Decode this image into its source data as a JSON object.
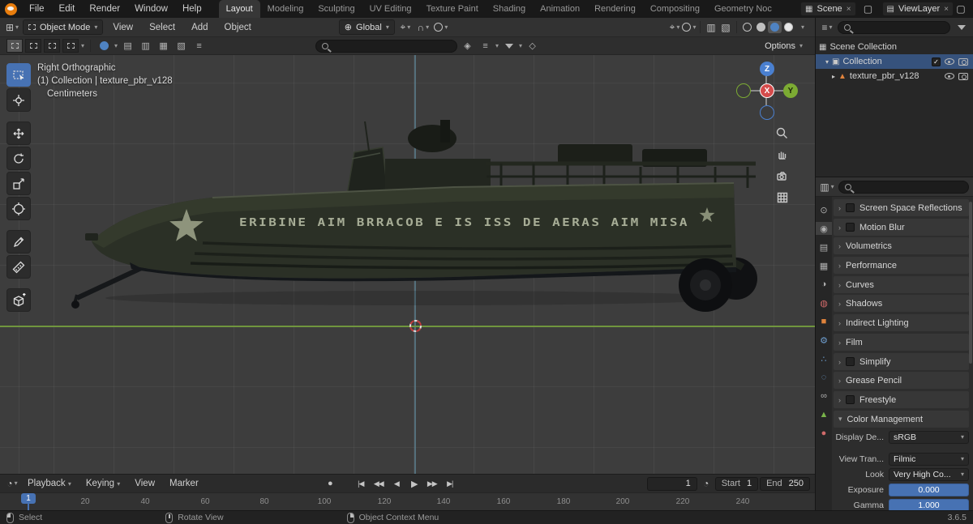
{
  "topbar": {
    "menus": [
      "File",
      "Edit",
      "Render",
      "Window",
      "Help"
    ],
    "workspaces": [
      "Layout",
      "Modeling",
      "Sculpting",
      "UV Editing",
      "Texture Paint",
      "Shading",
      "Animation",
      "Rendering",
      "Compositing",
      "Geometry Noc"
    ],
    "scene_name": "Scene",
    "viewlayer_name": "ViewLayer"
  },
  "vph": {
    "mode": "Object Mode",
    "menus": [
      "View",
      "Select",
      "Add",
      "Object"
    ],
    "orientation": "Global"
  },
  "ts": {
    "options_label": "Options"
  },
  "vp": {
    "view_label": "Right Orthographic",
    "collection_label": "(1) Collection | texture_pbr_v128",
    "units_label": "Centimeters",
    "axis_z": "Z",
    "axis_x": "X",
    "axis_y": "Y",
    "boat_text": "ERIBINE AIM  BRRACOB E IS ISS DE AERAS AIM  MISA"
  },
  "outliner": {
    "scene_collection": "Scene Collection",
    "collection": "Collection",
    "object": "texture_pbr_v128"
  },
  "props": {
    "tabs": [
      {
        "name": "tool",
        "g": "⊙"
      },
      {
        "name": "render",
        "g": "◉"
      },
      {
        "name": "output",
        "g": "▤"
      },
      {
        "name": "view-layer",
        "g": "▦"
      },
      {
        "name": "scene",
        "g": "◑"
      },
      {
        "name": "world",
        "g": "◍"
      },
      {
        "name": "object",
        "g": "■"
      },
      {
        "name": "modifiers",
        "g": "⚙"
      },
      {
        "name": "particles",
        "g": "∴"
      },
      {
        "name": "physics",
        "g": "◌"
      },
      {
        "name": "constraints",
        "g": "∞"
      },
      {
        "name": "object-data",
        "g": "▲"
      },
      {
        "name": "material",
        "g": "●"
      }
    ],
    "panels": [
      {
        "label": "Screen Space Reflections"
      },
      {
        "label": "Motion Blur"
      },
      {
        "label": "Volumetrics"
      },
      {
        "label": "Performance"
      },
      {
        "label": "Curves"
      },
      {
        "label": "Shadows"
      },
      {
        "label": "Indirect Lighting"
      },
      {
        "label": "Film"
      },
      {
        "label": "Simplify"
      },
      {
        "label": "Grease Pencil"
      },
      {
        "label": "Freestyle"
      },
      {
        "label": "Color Management"
      }
    ],
    "cm": [
      {
        "label": "Display De...",
        "value": "sRGB"
      },
      {
        "label": "View Tran...",
        "value": "Filmic"
      },
      {
        "label": "Look",
        "value": "Very High Co..."
      },
      {
        "label": "Exposure",
        "value": "0.000"
      },
      {
        "label": "Gamma",
        "value": "1.000"
      }
    ]
  },
  "tl": {
    "menus": [
      "Playback",
      "Keying",
      "View",
      "Marker"
    ],
    "current_frame": "1",
    "start_label": "Start",
    "start_value": "1",
    "end_label": "End",
    "end_value": "250",
    "ticks": [
      "20",
      "40",
      "60",
      "80",
      "100",
      "120",
      "140",
      "160",
      "180",
      "200",
      "220",
      "240"
    ]
  },
  "sb": {
    "select": "Select",
    "rotate": "Rotate View",
    "context": "Object Context Menu",
    "version": "3.6.5"
  },
  "icons": {
    "caret": "▾",
    "chevron": "›",
    "disclosure_open": "▾",
    "disclosure_closed": "▸",
    "check": "✓",
    "close": "×",
    "new_page": "▢",
    "plus": "+",
    "magnet": "∩",
    "globe": "⊕",
    "pivot": "⌖",
    "grid_editor": "⊞",
    "layers": "▤",
    "stack": "▥",
    "grid2": "▦",
    "pattern": "▧",
    "lines": "≡",
    "bookmark": "◈",
    "shield": "◇",
    "scene_collection": "▦",
    "collection": "▣",
    "mesh_object": "▲",
    "clock": "◔",
    "record": "●",
    "jump_first": "|◀",
    "prev_key": "◀◀",
    "play_back": "◀",
    "play": "▶",
    "next_key": "▶▶",
    "jump_last": "▶|"
  },
  "colors": {
    "accent": "#4772b3",
    "object_orange": "#e0833c",
    "axis_x": "#d54c4c",
    "axis_y": "#7cab33",
    "axis_z": "#4a80d0",
    "selection_row": "#36527c",
    "horizon_green": "#739b3e"
  }
}
